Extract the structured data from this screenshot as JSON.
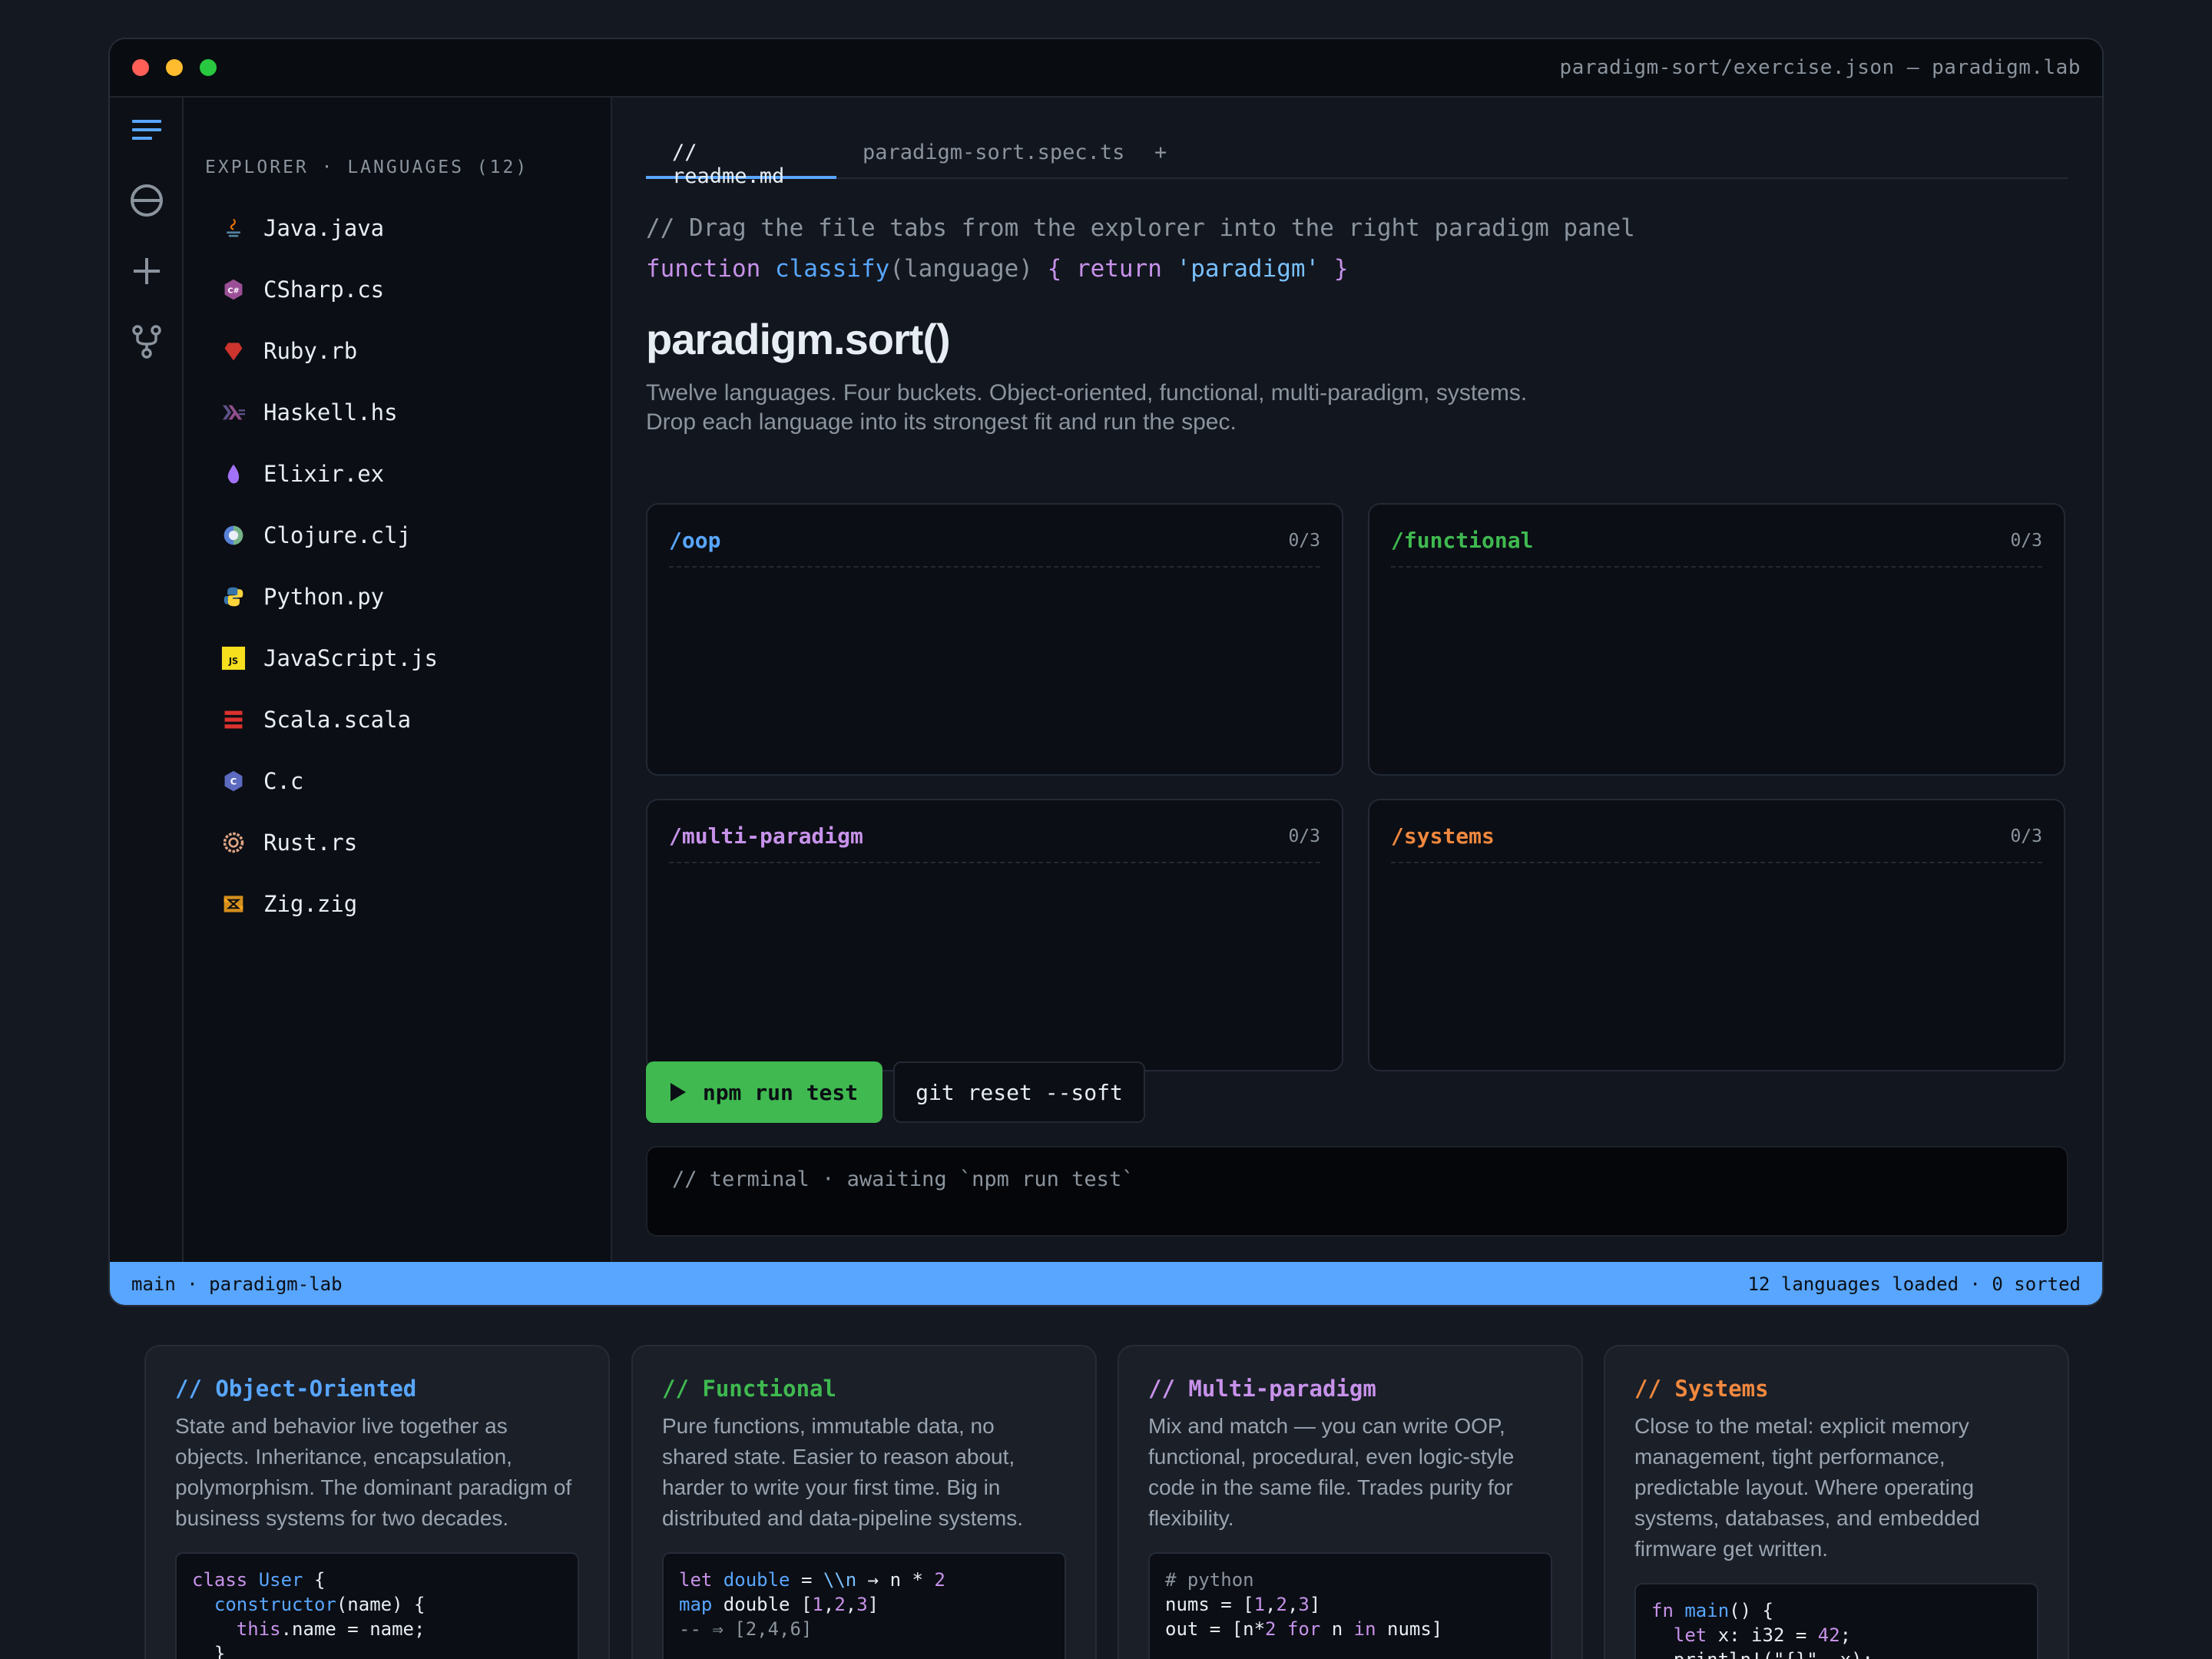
{
  "window": {
    "title": "paradigm-sort/exercise.json — paradigm.lab"
  },
  "activity_bar": [
    "menu-icon",
    "extensions-icon",
    "add-icon",
    "source-control-icon"
  ],
  "explorer": {
    "title": "EXPLORER · LANGUAGES (12)",
    "files": [
      {
        "name": "Java.java",
        "icon": "java-icon",
        "color": "#e76f00"
      },
      {
        "name": "CSharp.cs",
        "icon": "csharp-icon",
        "color": "#9b4f96"
      },
      {
        "name": "Ruby.rb",
        "icon": "ruby-icon",
        "color": "#cc342d"
      },
      {
        "name": "Haskell.hs",
        "icon": "haskell-icon",
        "color": "#5e5086"
      },
      {
        "name": "Elixir.ex",
        "icon": "elixir-icon",
        "color": "#a371f7"
      },
      {
        "name": "Clojure.clj",
        "icon": "clojure-icon",
        "color": "#5881d8"
      },
      {
        "name": "Python.py",
        "icon": "python-icon",
        "color": "#3776ab"
      },
      {
        "name": "JavaScript.js",
        "icon": "javascript-icon",
        "color": "#f7df1e"
      },
      {
        "name": "Scala.scala",
        "icon": "scala-icon",
        "color": "#dc322f"
      },
      {
        "name": "C.c",
        "icon": "c-icon",
        "color": "#5c6bc0"
      },
      {
        "name": "Rust.rs",
        "icon": "rust-icon",
        "color": "#dea584"
      },
      {
        "name": "Zig.zig",
        "icon": "zig-icon",
        "color": "#f7a41d"
      }
    ]
  },
  "tabs": [
    {
      "label": "// readme.md",
      "active": true
    },
    {
      "label": "paradigm-sort.spec.ts",
      "active": false
    },
    {
      "label": "+",
      "active": false
    }
  ],
  "readme": {
    "comment": "// Drag the file tabs from the explorer into the right paradigm panel",
    "code": {
      "kw": "function",
      "fn": "classify",
      "params": "(language)",
      "open": " { ",
      "ret": "return",
      "str": " 'paradigm'",
      "close": " }"
    },
    "title": "paradigm.sort()",
    "lede1": "Twelve languages. Four buckets. Object-oriented, functional, multi-paradigm, systems.",
    "lede2": "Drop each language into its strongest fit and run the spec."
  },
  "buckets": [
    {
      "name": "/oop",
      "count": "0/3",
      "color": "#58a6ff"
    },
    {
      "name": "/functional",
      "count": "0/3",
      "color": "#3fb950"
    },
    {
      "name": "/multi-paradigm",
      "count": "0/3",
      "color": "#c792ea"
    },
    {
      "name": "/systems",
      "count": "0/3",
      "color": "#f0883e"
    }
  ],
  "actions": {
    "run": "npm run test",
    "reset": "git reset --soft"
  },
  "terminal": {
    "text": "// terminal · awaiting `npm run test`"
  },
  "statusbar": {
    "left": "main · paradigm-lab",
    "right": "12 languages loaded · 0 sorted"
  },
  "cards": [
    {
      "title": "// Object-Oriented",
      "color": "#58a6ff",
      "body": "State and behavior live together as objects. Inheritance, encapsulation, polymorphism. The dominant paradigm of business systems for two decades."
    },
    {
      "title": "// Functional",
      "color": "#3fb950",
      "body": "Pure functions, immutable data, no shared state. Easier to reason about, harder to write your first time. Big in distributed and data-pipeline systems."
    },
    {
      "title": "// Multi-paradigm",
      "color": "#c792ea",
      "body": "Mix and match — you can write OOP, functional, procedural, even logic-style code in the same file. Trades purity for flexibility."
    },
    {
      "title": "// Systems",
      "color": "#f0883e",
      "body": "Close to the metal: explicit memory management, tight performance, predictable layout. Where operating systems, databases, and embedded firmware get written."
    }
  ],
  "snippets": {
    "oop": {
      "l1kw": "class",
      "l1cls": " User",
      "l1rest": " {",
      "l2fn": "  constructor",
      "l2rest": "(name) {",
      "l3kw": "    this",
      "l3rest": ".name = name;",
      "l4": "  }"
    },
    "functional": {
      "l1kw": "let",
      "l1fn": " double",
      "l1a": " = ",
      "l1lam": "\\\\n",
      "l1b": " → n * ",
      "l1num": "2",
      "l2fn": "map",
      "l2a": " double [",
      "l2n1": "1",
      "l2c1": ",",
      "l2n2": "2",
      "l2c2": ",",
      "l2n3": "3",
      "l2b": "]",
      "l3": "-- ⇒ [2,4,6]"
    },
    "multi": {
      "l1": "# python",
      "l2a": "nums = [",
      "l2n1": "1",
      "l2c1": ",",
      "l2n2": "2",
      "l2c2": ",",
      "l2n3": "3",
      "l2b": "]",
      "l3a": "out = [n*",
      "l3n": "2",
      "l3kw1": " for",
      "l3b": " n ",
      "l3kw2": "in",
      "l3c": " nums]"
    },
    "systems": {
      "l1kw": "fn",
      "l1fn": " main",
      "l1rest": "() {",
      "l2kw": "  let",
      "l2a": " x: i32 = ",
      "l2num": "42",
      "l2b": ";",
      "l3": "  println!(\"{}\", x);"
    }
  }
}
